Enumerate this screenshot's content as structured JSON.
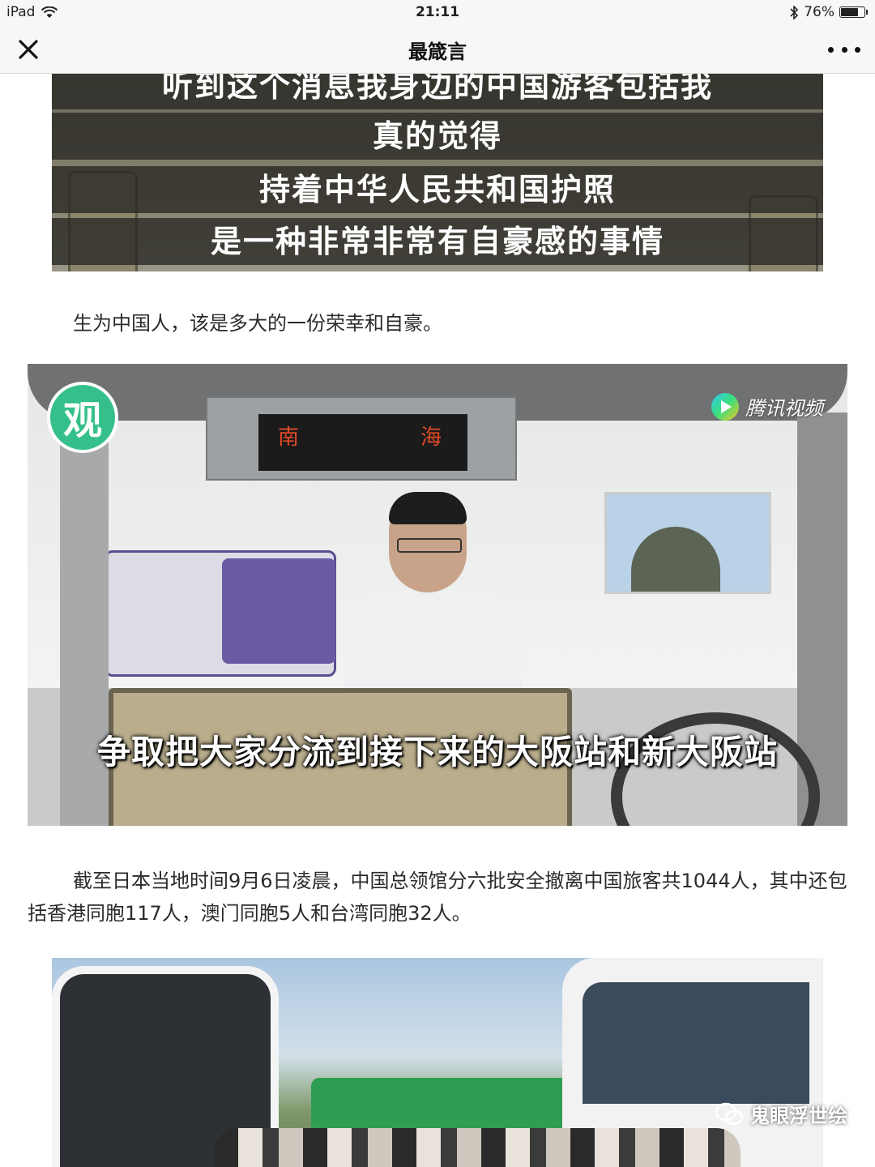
{
  "status_bar": {
    "device": "iPad",
    "time": "21:11",
    "battery_text": "76%",
    "battery_level": 0.76
  },
  "nav": {
    "title": "最箴言",
    "close_icon": "close-icon",
    "more_icon": "more-icon"
  },
  "image1": {
    "lines": [
      "听到这个消息我身边的中国游客包括我",
      "真的觉得",
      "持着中华人民共和国护照",
      "是一种非常非常有自豪感的事情"
    ]
  },
  "paragraph1": "生为中国人，该是多大的一份荣幸和自豪。",
  "image2": {
    "logo_text": "观",
    "brand_text": "腾讯视频",
    "led_left": "南",
    "led_right": "海",
    "subtitle": "争取把大家分流到接下来的大阪站和新大阪站"
  },
  "paragraph2": "截至日本当地时间9月6日凌晨，中国总领馆分六批安全撤离中国旅客共1044人，其中还包括香港同胞117人，澳门同胞5人和台湾同胞32人。",
  "image3": {
    "watermark": "鬼眼浮世绘"
  },
  "colors": {
    "nav_bg": "#f7f7f7",
    "logo_green": "#35c08b",
    "led_text": "#e04a25"
  }
}
